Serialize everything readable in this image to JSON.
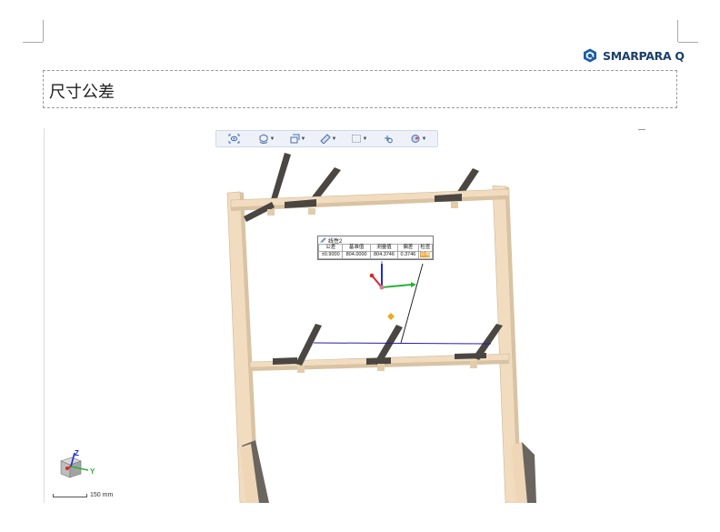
{
  "logo": {
    "text": "SMARPARA Q",
    "mark_color": "#1b5ea8"
  },
  "section_title": "尺寸公差",
  "toolbar": {
    "buttons": [
      {
        "icon": "view-fit-icon",
        "dropdown": false
      },
      {
        "icon": "view-orientation-icon",
        "dropdown": true
      },
      {
        "icon": "section-box-icon",
        "dropdown": true
      },
      {
        "icon": "measure-ruler-icon",
        "dropdown": true
      },
      {
        "icon": "selection-box-icon",
        "dropdown": true
      },
      {
        "icon": "pick-point-icon",
        "dropdown": false
      },
      {
        "icon": "render-style-icon",
        "dropdown": true
      }
    ]
  },
  "measurement_tag": {
    "name": "线性2",
    "headers": [
      "公差",
      "基准值",
      "测量值",
      "偏差",
      "检查"
    ],
    "values": [
      "±0.9000",
      "804.0000",
      "804.3746",
      "0.3746",
      "合格"
    ],
    "status_color": "#f0a030"
  },
  "axis_triad": {
    "x": "X",
    "y": "Y",
    "z": "Z"
  },
  "scale_bar": {
    "label": "150 mm"
  },
  "colors": {
    "wood": "#f1dcc0",
    "wood_shade": "#d9c3a3",
    "beam_dark": "#4a4641",
    "measure_line": "#2a1aa8"
  }
}
